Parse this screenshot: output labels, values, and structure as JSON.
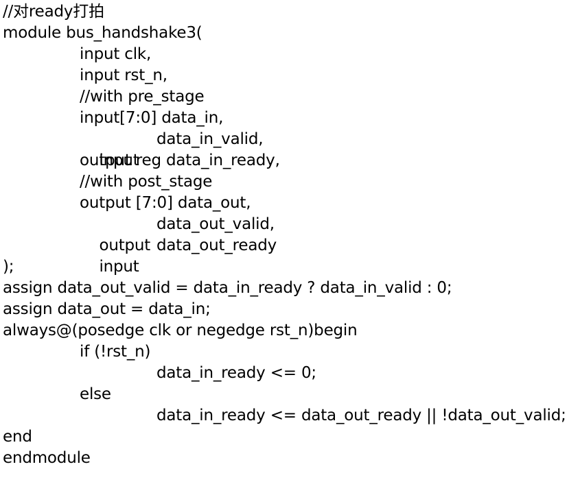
{
  "lines": {
    "l01": "//对ready打拍",
    "l02": "module bus_handshake3(",
    "l03": "input clk,",
    "l04": "input rst_n,",
    "l05": "//with pre_stage",
    "l06": "input[7:0] data_in,",
    "l07_kw": "input",
    "l07_id": "data_in_valid,",
    "l08": "output reg data_in_ready,",
    "l09": "//with post_stage",
    "l10": "output [7:0] data_out,",
    "l11_kw": "output",
    "l11_id": "data_out_valid,",
    "l12_kw": "input",
    "l12_id": "data_out_ready",
    "l13": ");",
    "l14": "assign data_out_valid = data_in_ready ? data_in_valid : 0;",
    "l15": "assign data_out = data_in;",
    "l16": "always@(posedge clk or negedge rst_n)begin",
    "l17": "if (!rst_n)",
    "l18": "data_in_ready <= 0;",
    "l19": "else",
    "l20": "data_in_ready <= data_out_ready || !data_out_valid;",
    "l21": "end",
    "l22": "endmodule"
  }
}
